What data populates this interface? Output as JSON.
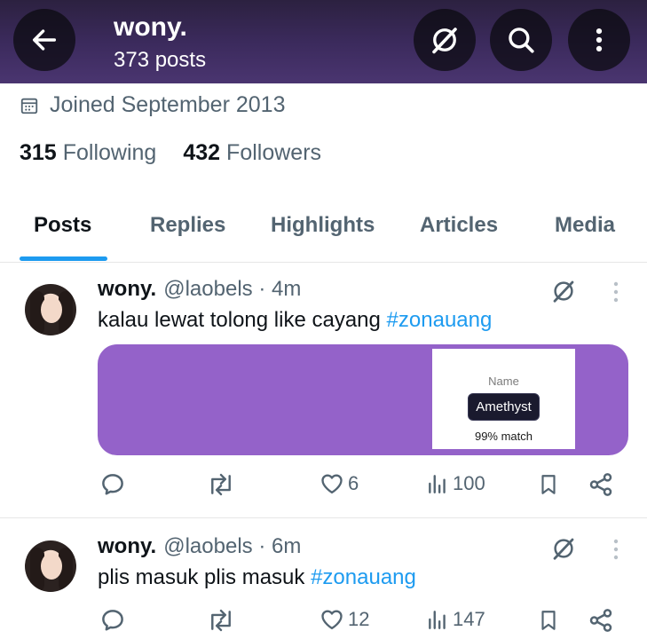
{
  "header": {
    "title": "wony.",
    "post_count": "373 posts",
    "back_icon": "arrow-left-icon",
    "grok_icon": "grok-icon",
    "search_icon": "search-icon",
    "more_icon": "more-vertical-icon"
  },
  "profile": {
    "joined": "Joined September 2013",
    "following_count": "315",
    "following_label": "Following",
    "followers_count": "432",
    "followers_label": "Followers"
  },
  "tabs": [
    {
      "label": "Posts",
      "active": true
    },
    {
      "label": "Replies",
      "active": false
    },
    {
      "label": "Highlights",
      "active": false
    },
    {
      "label": "Articles",
      "active": false
    },
    {
      "label": "Media",
      "active": false
    }
  ],
  "posts": [
    {
      "name": "wony.",
      "handle": "@laobels · 4m",
      "text": "kalau lewat tolong like cayang ",
      "hashtag": "#zonauang",
      "card": {
        "name_label": "Name",
        "value": "Amethyst",
        "match": "99% match",
        "color": "#9462c9"
      },
      "likes": "6",
      "views": "100"
    },
    {
      "name": "wony.",
      "handle": "@laobels · 6m",
      "text": "plis masuk plis masuk ",
      "hashtag": "#zonauang",
      "likes": "12",
      "views": "147"
    }
  ],
  "colors": {
    "accent": "#1d9bf0",
    "header_bg": "#3b2a5c",
    "secondary_text": "#536471"
  }
}
